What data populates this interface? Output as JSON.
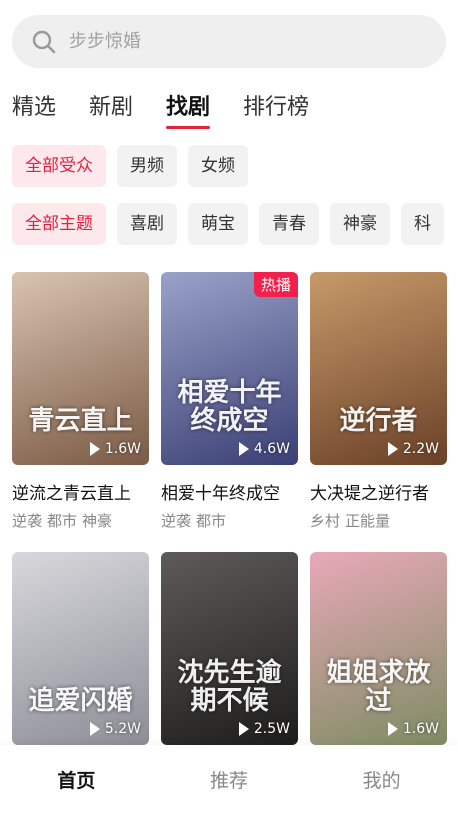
{
  "search": {
    "placeholder": "步步惊婚",
    "icon": "search-icon"
  },
  "tabs": [
    {
      "label": "精选",
      "active": false
    },
    {
      "label": "新剧",
      "active": false
    },
    {
      "label": "找剧",
      "active": true
    },
    {
      "label": "排行榜",
      "active": false
    }
  ],
  "filters": {
    "audience": [
      {
        "label": "全部受众",
        "active": true
      },
      {
        "label": "男频",
        "active": false
      },
      {
        "label": "女频",
        "active": false
      }
    ],
    "theme": [
      {
        "label": "全部主题",
        "active": true
      },
      {
        "label": "喜剧",
        "active": false
      },
      {
        "label": "萌宝",
        "active": false
      },
      {
        "label": "青春",
        "active": false
      },
      {
        "label": "神豪",
        "active": false
      },
      {
        "label": "科",
        "active": false
      }
    ]
  },
  "dramas": [
    {
      "title": "逆流之青云直上",
      "poster_text": "青云直上",
      "plays": "1.6W",
      "badge": "",
      "tags": [
        "逆袭",
        "都市",
        "神豪"
      ],
      "colors": [
        "#d9c4b0",
        "#7a5a45"
      ]
    },
    {
      "title": "相爱十年终成空",
      "poster_text": "相爱十年终成空",
      "plays": "4.6W",
      "badge": "热播",
      "tags": [
        "逆袭",
        "都市"
      ],
      "colors": [
        "#9aa2c9",
        "#3b3f74"
      ]
    },
    {
      "title": "大决堤之逆行者",
      "poster_text": "逆行者",
      "plays": "2.2W",
      "badge": "",
      "tags": [
        "乡村",
        "正能量"
      ],
      "colors": [
        "#c79a6a",
        "#6b4127"
      ]
    },
    {
      "title": "",
      "poster_text": "追爱闪婚",
      "plays": "5.2W",
      "badge": "",
      "tags": [],
      "colors": [
        "#d8d8dc",
        "#8c8d96"
      ]
    },
    {
      "title": "",
      "poster_text": "沈先生逾期不候",
      "plays": "2.5W",
      "badge": "",
      "tags": [],
      "colors": [
        "#5e5a5a",
        "#1f1c1c"
      ]
    },
    {
      "title": "",
      "poster_text": "姐姐求放过",
      "plays": "1.6W",
      "badge": "",
      "tags": [],
      "colors": [
        "#e8a9b8",
        "#7e8c63"
      ]
    }
  ],
  "bottom_nav": [
    {
      "label": "首页",
      "active": true
    },
    {
      "label": "推荐",
      "active": false
    },
    {
      "label": "我的",
      "active": false
    }
  ],
  "colors": {
    "accent": "#e0253b",
    "chip_active_bg": "#fde8ec",
    "chip_active_text": "#e51f3e",
    "badge": "#f2204a"
  }
}
